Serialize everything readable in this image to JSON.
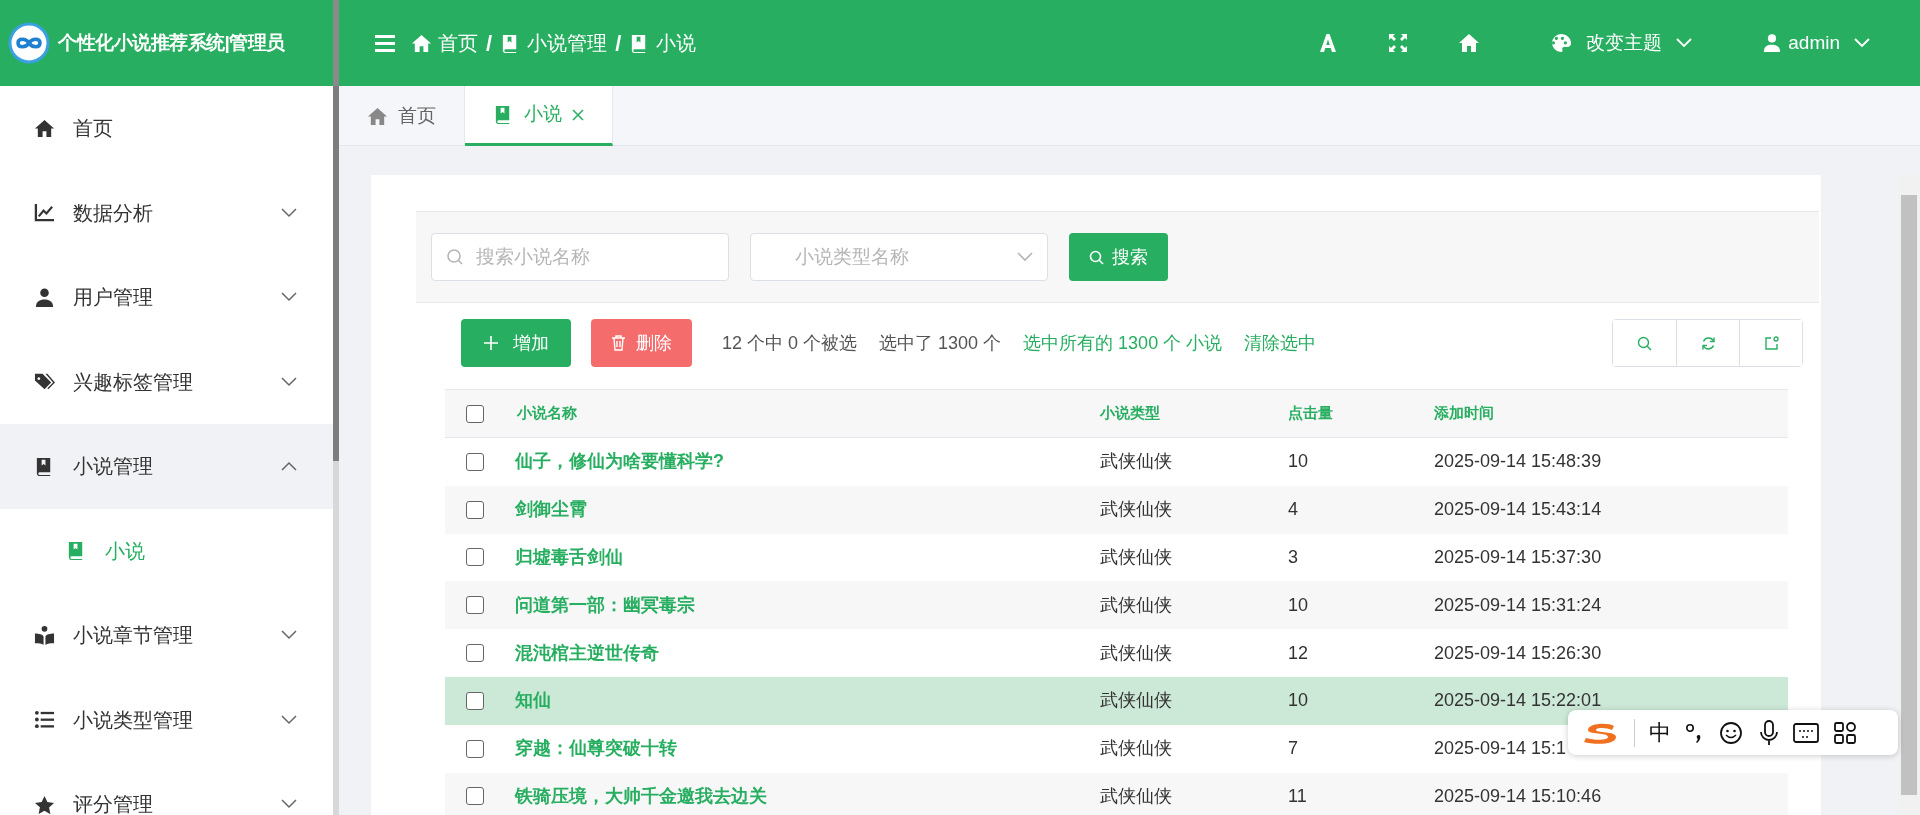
{
  "app_title": "个性化小说推荐系统|管理员",
  "breadcrumb": [
    {
      "kind": "crumb",
      "label": "首页"
    },
    {
      "kind": "sep",
      "label": "/"
    },
    {
      "kind": "crumb",
      "label": "小说管理"
    },
    {
      "kind": "sep",
      "label": "/"
    },
    {
      "kind": "crumb",
      "label": "小说"
    }
  ],
  "theme_menu": {
    "label": "改变主题"
  },
  "user_menu": {
    "label": "admin"
  },
  "sidebar": {
    "items": [
      {
        "label": "首页",
        "submenu": false,
        "expanded": false
      },
      {
        "label": "数据分析",
        "submenu": true,
        "expanded": false
      },
      {
        "label": "用户管理",
        "submenu": true,
        "expanded": false
      },
      {
        "label": "兴趣标签管理",
        "submenu": true,
        "expanded": false
      },
      {
        "label": "小说管理",
        "submenu": true,
        "expanded": true,
        "children": [
          {
            "label": "小说",
            "selected": true
          }
        ]
      },
      {
        "label": "小说章节管理",
        "submenu": true,
        "expanded": false
      },
      {
        "label": "小说类型管理",
        "submenu": true,
        "expanded": false
      },
      {
        "label": "评分管理",
        "submenu": true,
        "expanded": false
      }
    ]
  },
  "tabs": [
    {
      "label": "首页",
      "selected": false,
      "closable": false
    },
    {
      "label": "小说",
      "selected": true,
      "closable": true
    }
  ],
  "search": {
    "placeholder": "搜索小说名称"
  },
  "type_select": {
    "placeholder": "小说类型名称"
  },
  "search_button": "搜索",
  "add_button": "增加",
  "delete_button": "删除",
  "selection_info": [
    "12 个中 0 个被选",
    "选中了 1300 个"
  ],
  "selection_links": [
    "选中所有的 1300 个 小说",
    "清除选中"
  ],
  "table": {
    "select_all": false,
    "columns": [
      "小说名称",
      "小说类型",
      "点击量",
      "添加时间"
    ],
    "rows": [
      {
        "checked": false,
        "highlighted": false,
        "cells": [
          "仙子，修仙为啥要懂科学?",
          "武侠仙侠",
          "10",
          "2025-09-14 15:48:39"
        ]
      },
      {
        "checked": false,
        "highlighted": false,
        "cells": [
          "剑御尘霄",
          "武侠仙侠",
          "4",
          "2025-09-14 15:43:14"
        ]
      },
      {
        "checked": false,
        "highlighted": false,
        "cells": [
          "归墟毒舌剑仙",
          "武侠仙侠",
          "3",
          "2025-09-14 15:37:30"
        ]
      },
      {
        "checked": false,
        "highlighted": false,
        "cells": [
          "问道第一部：幽冥毒宗",
          "武侠仙侠",
          "10",
          "2025-09-14 15:31:24"
        ]
      },
      {
        "checked": false,
        "highlighted": false,
        "cells": [
          "混沌棺主逆世传奇",
          "武侠仙侠",
          "12",
          "2025-09-14 15:26:30"
        ]
      },
      {
        "checked": false,
        "highlighted": true,
        "cells": [
          "知仙",
          "武侠仙侠",
          "10",
          "2025-09-14 15:22:01"
        ]
      },
      {
        "checked": false,
        "highlighted": false,
        "cells": [
          "穿越：仙尊突破十转",
          "武侠仙侠",
          "7",
          "2025-09-14 15:1"
        ]
      },
      {
        "checked": false,
        "highlighted": false,
        "cells": [
          "铁骑压境，大帅千金邀我去边关",
          "武侠仙侠",
          "11",
          "2025-09-14 15:10:46"
        ]
      }
    ]
  },
  "ime_toolbar": {
    "mode": "中"
  }
}
